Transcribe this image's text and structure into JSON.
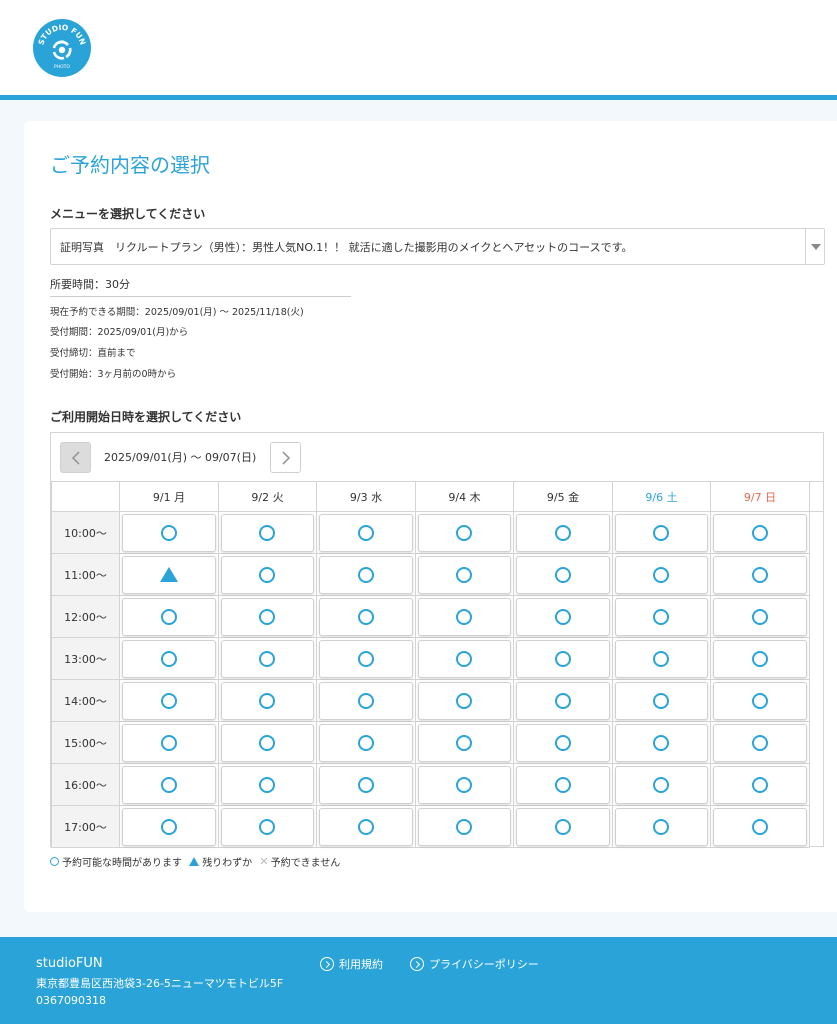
{
  "colors": {
    "accent": "#2aa4d8",
    "sunday": "#e8674a",
    "saturday": "#2aa4d8"
  },
  "header": {
    "logo_text_top": "STUDIO FUN",
    "logo_text_bottom": "PHOTO"
  },
  "page": {
    "title": "ご予約内容の選択"
  },
  "menu": {
    "label": "メニューを選択してください",
    "selected": "証明写真　リクルートプラン（男性）：男性人気NO.1！！ 就活に適した撮影用のメイクとヘアセットのコースです。",
    "duration": "所要時間：30分"
  },
  "info": {
    "period": "現在予約できる期間：2025/09/01(月) 〜 2025/11/18(火)",
    "reception_period": "受付期間：2025/09/01(月)から",
    "deadline": "受付締切：直前まで",
    "start": "受付開始：3ヶ月前の0時から"
  },
  "calendar": {
    "label": "ご利用開始日時を選択してください",
    "range": "2025/09/01(月) 〜 09/07(日)",
    "days": [
      {
        "label": "9/1 月",
        "type": "weekday"
      },
      {
        "label": "9/2 火",
        "type": "weekday"
      },
      {
        "label": "9/3 水",
        "type": "weekday"
      },
      {
        "label": "9/4 木",
        "type": "weekday"
      },
      {
        "label": "9/5 金",
        "type": "weekday"
      },
      {
        "label": "9/6 土",
        "type": "sat"
      },
      {
        "label": "9/7 日",
        "type": "sun"
      }
    ],
    "rows": [
      {
        "time": "10:00〜",
        "slots": [
          "available",
          "available",
          "available",
          "available",
          "available",
          "available",
          "available"
        ]
      },
      {
        "time": "11:00〜",
        "slots": [
          "few",
          "available",
          "available",
          "available",
          "available",
          "available",
          "available"
        ]
      },
      {
        "time": "12:00〜",
        "slots": [
          "available",
          "available",
          "available",
          "available",
          "available",
          "available",
          "available"
        ]
      },
      {
        "time": "13:00〜",
        "slots": [
          "available",
          "available",
          "available",
          "available",
          "available",
          "available",
          "available"
        ]
      },
      {
        "time": "14:00〜",
        "slots": [
          "available",
          "available",
          "available",
          "available",
          "available",
          "available",
          "available"
        ]
      },
      {
        "time": "15:00〜",
        "slots": [
          "available",
          "available",
          "available",
          "available",
          "available",
          "available",
          "available"
        ]
      },
      {
        "time": "16:00〜",
        "slots": [
          "available",
          "available",
          "available",
          "available",
          "available",
          "available",
          "available"
        ]
      },
      {
        "time": "17:00〜",
        "slots": [
          "available",
          "available",
          "available",
          "available",
          "available",
          "available",
          "available"
        ]
      }
    ]
  },
  "legend": {
    "available": "予約可能な時間があります",
    "few": "残りわずか",
    "none": "予約できません"
  },
  "footer": {
    "company": "studioFUN",
    "address": "東京都豊島区西池袋3-26-5ニューマツモトビル5F",
    "tel": "0367090318",
    "terms": "利用規約",
    "privacy": "プライバシーポリシー"
  }
}
